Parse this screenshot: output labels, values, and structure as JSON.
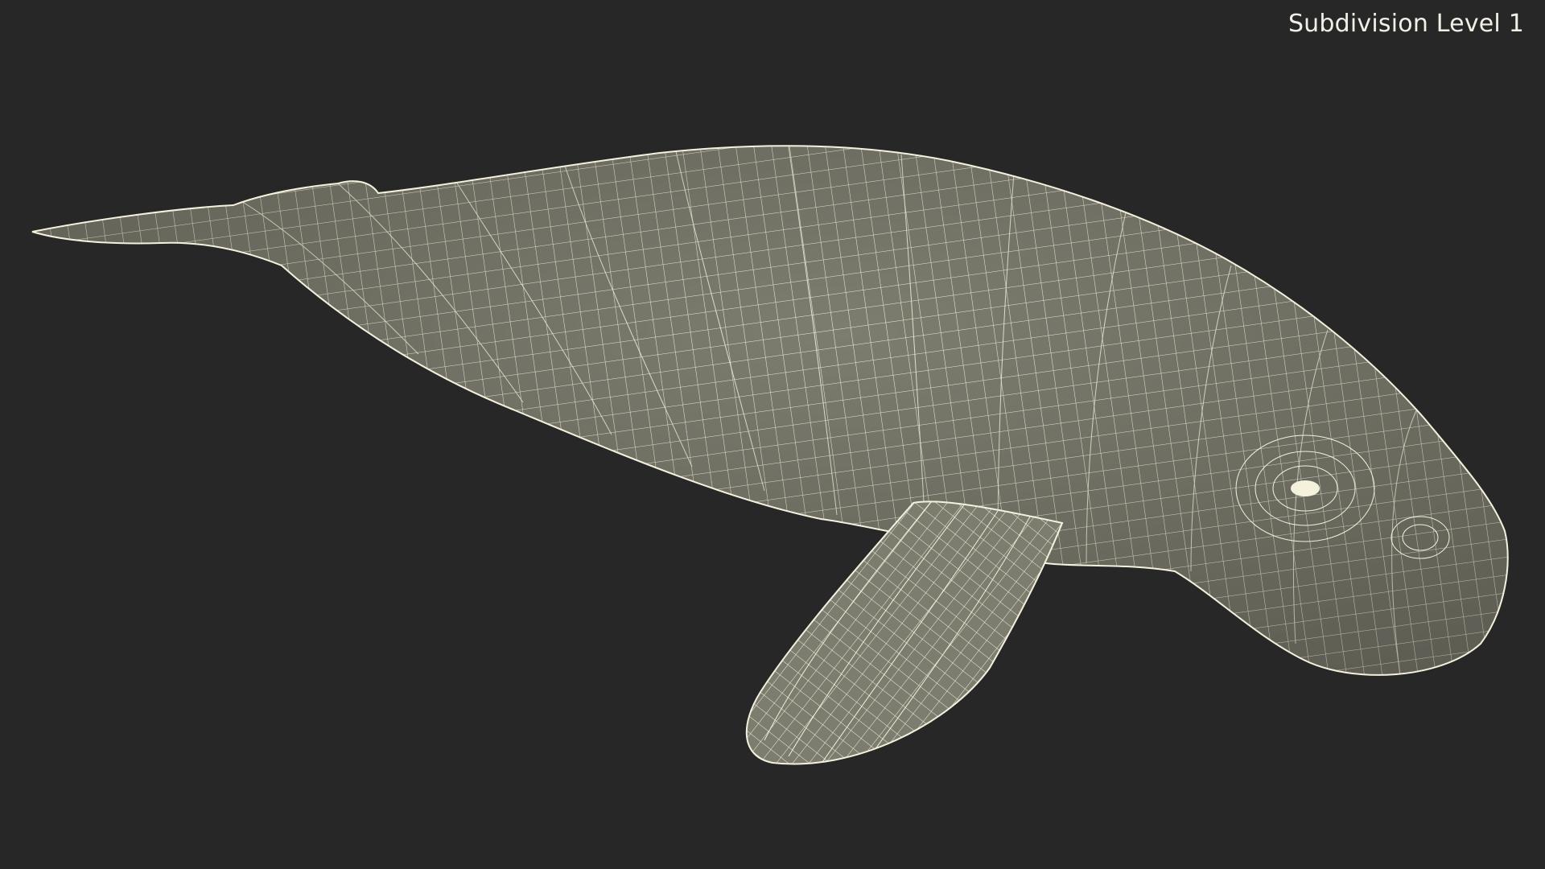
{
  "viewport": {
    "subdivision_label": "Subdivision Level 1",
    "background_color": "#272727",
    "mesh_fill_color": "#7c7c6f",
    "wire_color": "#f4f1dd"
  },
  "model": {
    "subject": "dugong-wireframe-mesh"
  }
}
